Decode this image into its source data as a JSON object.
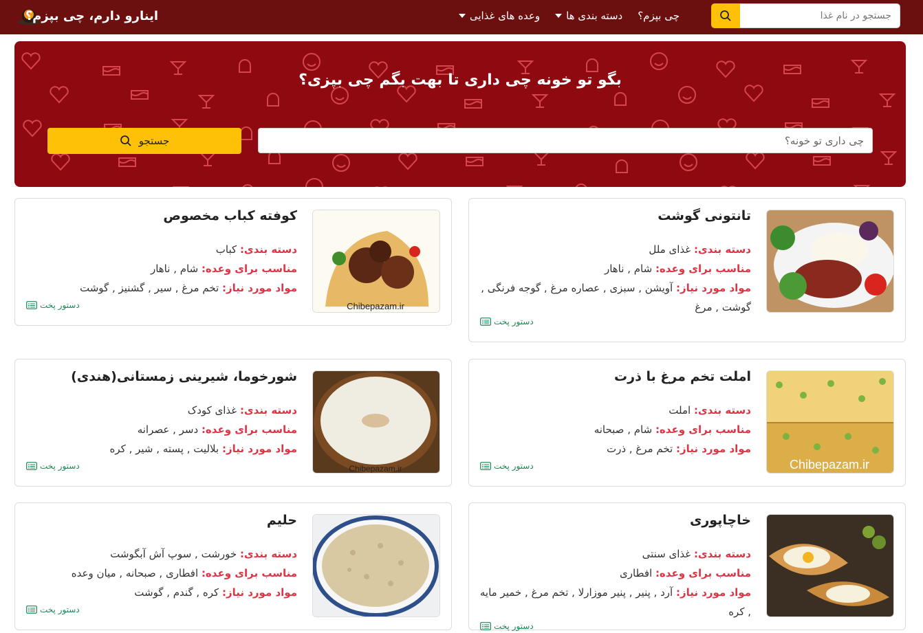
{
  "navbar": {
    "brand": "اینارو دارم، چی بپزم؟",
    "menu": [
      "چی بپزم؟",
      "دسته بندی ها",
      "وعده های غذایی"
    ],
    "search_placeholder": "جستجو در نام غذا",
    "colors": {
      "bg": "#6b0f0f",
      "accent": "#ffc107"
    }
  },
  "hero": {
    "title": "بگو تو خونه چی داری تا بهت بگم چی بپزی؟",
    "input_placeholder": "چی داری تو خونه؟",
    "button_label": "جستجو",
    "colors": {
      "bg": "#8e0a10",
      "pattern": "#e9545a"
    }
  },
  "labels": {
    "category": "دسته بندی:",
    "meal": "مناسب برای وعده:",
    "ingredients": "مواد مورد نیاز:",
    "recipe": "دستور پخت"
  },
  "recipes": [
    {
      "title": "تانتونی گوشت",
      "category": "غذای ملل",
      "meal": "شام , ناهار",
      "ingredients": "آویشن , سبزی , عصاره مرغ , گوجه فرنگی , گوشت , مرغ",
      "image": "meat-rice-plate"
    },
    {
      "title": "کوفته کباب مخصوص",
      "category": "کباب",
      "meal": "شام , ناهار",
      "ingredients": "تخم مرغ , سیر , گشنیز , گوشت",
      "image": "kofta-wrap",
      "watermark": "Chibepazam.ir"
    },
    {
      "title": "املت تخم مرغ با ذرت",
      "category": "املت",
      "meal": "شام , صبحانه",
      "ingredients": "تخم مرغ , ذرت",
      "image": "corn-omelette",
      "watermark": "Chibepazam.ir"
    },
    {
      "title": "شورخوما، شیرینی زمستانی(هندی)",
      "category": "غذای کودک",
      "meal": "دسر , عصرانه",
      "ingredients": "بلالیت , پسته , شیر , کره",
      "image": "milk-pudding",
      "watermark": "Chibepazam.ir"
    },
    {
      "title": "خاچاپوری",
      "category": "غذای سنتی",
      "meal": "افطاری",
      "ingredients": "آرد , پنیر , پنیر موزارلا , تخم مرغ , خمیر مایه , کره",
      "image": "khachapuri"
    },
    {
      "title": "حلیم",
      "category": "خورشت , سوپ آش آبگوشت",
      "meal": "افطاری , صبحانه , میان وعده",
      "ingredients": "کره , گندم , گوشت",
      "image": "haleem-bowl"
    }
  ]
}
